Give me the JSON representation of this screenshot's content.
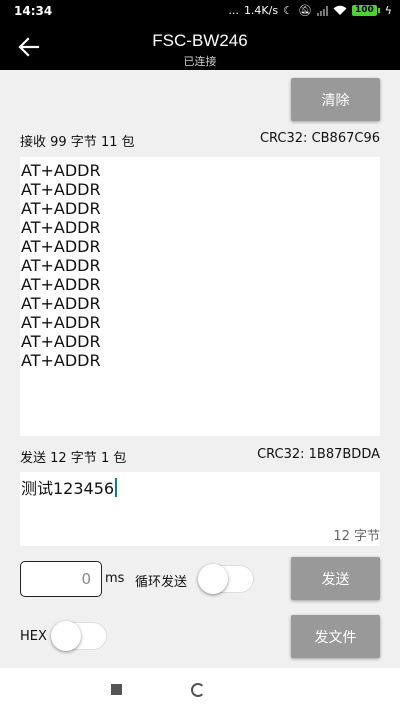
{
  "status_bar": {
    "time": "14:34",
    "dots": "...",
    "net_speed": "1.4K/s",
    "battery": "100"
  },
  "app_bar": {
    "title": "FSC-BW246",
    "subtitle": "已连接"
  },
  "clear_button": "清除",
  "receive": {
    "summary": "接收 99 字节 11 包",
    "crc": "CRC32: CB867C96",
    "lines": [
      "AT+ADDR",
      "AT+ADDR",
      "AT+ADDR",
      "AT+ADDR",
      "AT+ADDR",
      "AT+ADDR",
      "AT+ADDR",
      "AT+ADDR",
      "AT+ADDR",
      "AT+ADDR",
      "AT+ADDR"
    ]
  },
  "send": {
    "summary": "发送 12 字节 1 包",
    "crc": "CRC32: 1B87BDDA",
    "input_value": "测试123456",
    "byte_count": "12 字节"
  },
  "controls": {
    "interval_value": "0",
    "interval_unit": "ms",
    "loop_send_label": "循环发送",
    "loop_send_on": false,
    "send_button": "发送",
    "hex_label": "HEX",
    "hex_on": false,
    "send_file_button": "发文件"
  },
  "colors": {
    "button": "#999999",
    "caret": "#00897b",
    "battery": "#4cd137"
  }
}
